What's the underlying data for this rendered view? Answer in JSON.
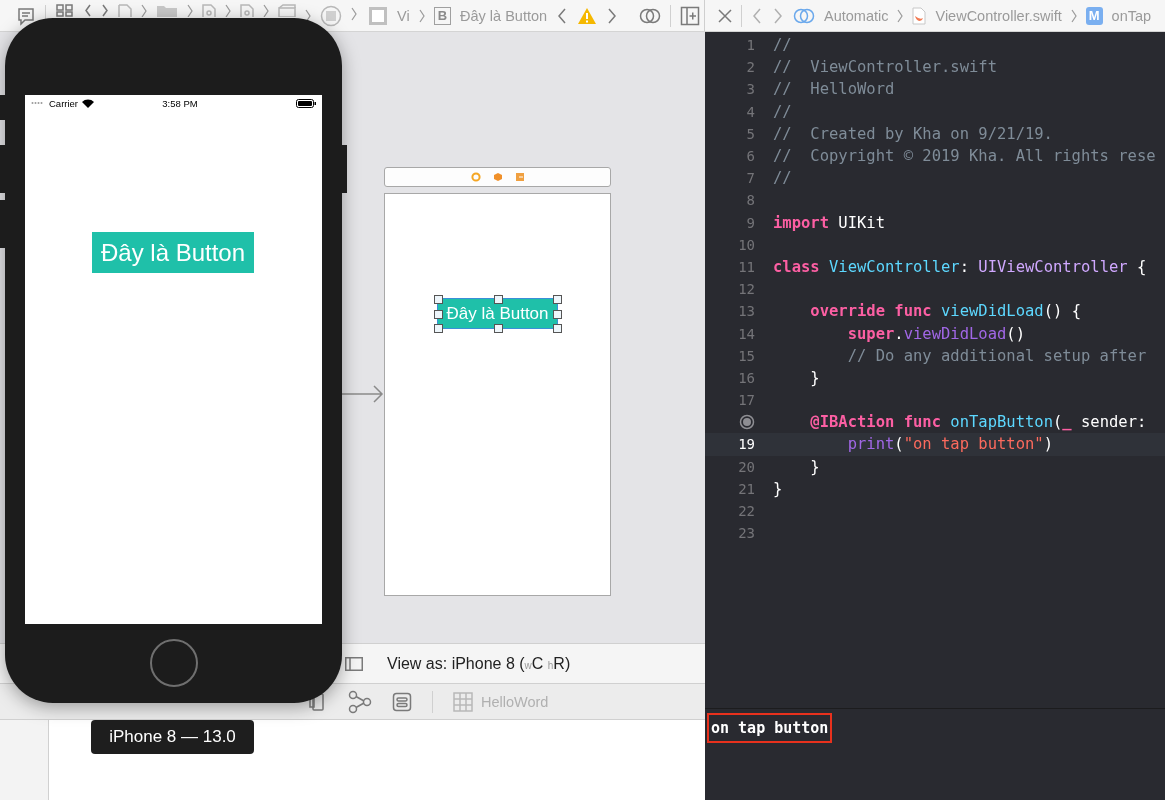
{
  "jump_bar": {
    "crumb": "Vi",
    "badge": "B",
    "element": "Đây là Button"
  },
  "assistant_bar": {
    "mode": "Automatic",
    "file": "ViewController.swift",
    "symbol_badge": "M",
    "symbol": "onTap"
  },
  "storyboard": {
    "button_label": "Đây là Button"
  },
  "view_as": "View as: iPhone 8 ($_{w}$C $_{h}$R)",
  "scheme": "HelloWord",
  "simulator": {
    "carrier": "Carrier",
    "time": "3:58 PM",
    "button_label": "Đây là Button",
    "tooltip": "iPhone 8 — 13.0"
  },
  "code": {
    "lines": [
      {
        "number": "1",
        "current": false,
        "breakpoint": false,
        "tokens": [
          {
            "kind": "comment",
            "text": "//"
          }
        ]
      },
      {
        "number": "2",
        "current": false,
        "breakpoint": false,
        "tokens": [
          {
            "kind": "comment",
            "text": "//  ViewController.swift"
          }
        ]
      },
      {
        "number": "3",
        "current": false,
        "breakpoint": false,
        "tokens": [
          {
            "kind": "comment",
            "text": "//  HelloWord"
          }
        ]
      },
      {
        "number": "4",
        "current": false,
        "breakpoint": false,
        "tokens": [
          {
            "kind": "comment",
            "text": "//"
          }
        ]
      },
      {
        "number": "5",
        "current": false,
        "breakpoint": false,
        "tokens": [
          {
            "kind": "comment",
            "text": "//  Created by Kha on 9/21/19."
          }
        ]
      },
      {
        "number": "6",
        "current": false,
        "breakpoint": false,
        "tokens": [
          {
            "kind": "comment",
            "text": "//  Copyright © 2019 Kha. All rights rese"
          }
        ]
      },
      {
        "number": "7",
        "current": false,
        "breakpoint": false,
        "tokens": [
          {
            "kind": "comment",
            "text": "//"
          }
        ]
      },
      {
        "number": "8",
        "current": false,
        "breakpoint": false
      },
      {
        "number": "9",
        "current": false,
        "breakpoint": false,
        "tokens": [
          {
            "kind": "keyword",
            "text": "import"
          },
          {
            "kind": "plain",
            "text": " UIKit"
          }
        ]
      },
      {
        "number": "10",
        "current": false,
        "breakpoint": false
      },
      {
        "number": "11",
        "current": false,
        "breakpoint": false,
        "tokens": [
          {
            "kind": "keyword",
            "text": "class"
          },
          {
            "kind": "declaration",
            "text": " ViewController"
          },
          {
            "kind": "plain",
            "text": ": "
          },
          {
            "kind": "type",
            "text": "UIViewController"
          },
          {
            "kind": "plain",
            "text": " {"
          }
        ]
      },
      {
        "number": "12",
        "current": false,
        "breakpoint": false
      },
      {
        "number": "13",
        "current": false,
        "breakpoint": false,
        "tokens": [
          {
            "kind": "keyword",
            "text": "    override"
          },
          {
            "kind": "keyword",
            "text": " func"
          },
          {
            "kind": "declaration",
            "text": " viewDidLoad"
          },
          {
            "kind": "plain",
            "text": "() {"
          }
        ]
      },
      {
        "number": "14",
        "current": false,
        "breakpoint": false,
        "tokens": [
          {
            "kind": "keyword",
            "text": "        super"
          },
          {
            "kind": "plain",
            "text": "."
          },
          {
            "kind": "call",
            "text": "viewDidLoad"
          },
          {
            "kind": "plain",
            "text": "()"
          }
        ]
      },
      {
        "number": "15",
        "current": false,
        "breakpoint": false,
        "tokens": [
          {
            "kind": "comment",
            "text": "        // Do any additional setup after"
          }
        ]
      },
      {
        "number": "16",
        "current": false,
        "breakpoint": false,
        "tokens": [
          {
            "kind": "plain",
            "text": "    }"
          }
        ]
      },
      {
        "number": "17",
        "current": false,
        "breakpoint": false
      },
      {
        "current": false,
        "breakpoint": true,
        "tokens": [
          {
            "kind": "keyword",
            "text": "    @IBAction"
          },
          {
            "kind": "keyword",
            "text": " func"
          },
          {
            "kind": "declaration",
            "text": " onTapButton"
          },
          {
            "kind": "plain",
            "text": "("
          },
          {
            "kind": "keyword",
            "text": "_"
          },
          {
            "kind": "plain",
            "text": " sender:"
          }
        ]
      },
      {
        "number": "19",
        "current": true,
        "breakpoint": false,
        "tokens": [
          {
            "kind": "call",
            "text": "        print"
          },
          {
            "kind": "plain",
            "text": "("
          },
          {
            "kind": "string",
            "text": "\"on tap button\""
          },
          {
            "kind": "plain",
            "text": ")"
          }
        ]
      },
      {
        "number": "20",
        "current": false,
        "breakpoint": false,
        "tokens": [
          {
            "kind": "plain",
            "text": "    }"
          }
        ]
      },
      {
        "number": "21",
        "current": false,
        "breakpoint": false,
        "tokens": [
          {
            "kind": "plain",
            "text": "}"
          }
        ]
      },
      {
        "number": "22",
        "current": false,
        "breakpoint": false
      },
      {
        "number": "23",
        "current": false,
        "breakpoint": false
      }
    ]
  },
  "console": {
    "output": "on tap button"
  }
}
